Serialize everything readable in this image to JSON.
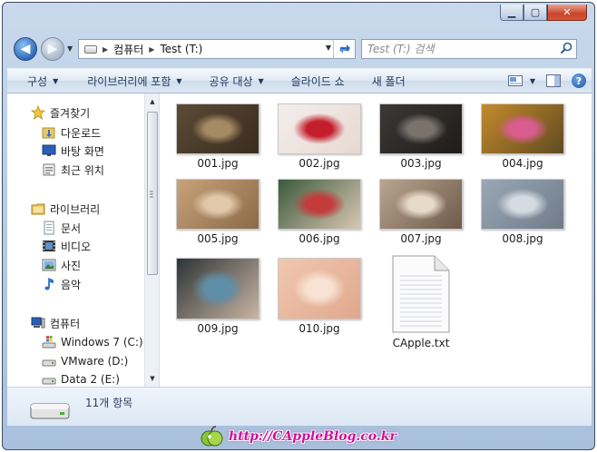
{
  "window": {
    "caption": {
      "minimize_glyph": "▁",
      "maximize_glyph": "▢",
      "close_glyph": "✕"
    }
  },
  "navbar": {
    "back_glyph": "◀",
    "forward_glyph": "▶",
    "breadcrumb": [
      "컴퓨터",
      "Test (T:)"
    ],
    "search_placeholder": "Test (T:) 검색"
  },
  "toolbar": {
    "items": [
      {
        "label": "구성",
        "has_caret": true
      },
      {
        "label": "라이브러리에 포함",
        "has_caret": true
      },
      {
        "label": "공유 대상",
        "has_caret": true
      },
      {
        "label": "슬라이드 쇼",
        "has_caret": false
      },
      {
        "label": "새 폴더",
        "has_caret": false
      }
    ],
    "help_glyph": "?"
  },
  "sidebar": {
    "favorites": {
      "label": "즐겨찾기",
      "items": [
        "다운로드",
        "바탕 화면",
        "최근 위치"
      ]
    },
    "libraries": {
      "label": "라이브러리",
      "items": [
        "문서",
        "비디오",
        "사진",
        "음악"
      ]
    },
    "computer": {
      "label": "컴퓨터",
      "items": [
        "Windows 7 (C:)",
        "VMware (D:)",
        "Data 2 (E:)"
      ]
    }
  },
  "files": [
    {
      "name": "001.jpg",
      "type": "image",
      "palette": [
        "#5b4a35",
        "#a58a63",
        "#3a2c1f"
      ]
    },
    {
      "name": "002.jpg",
      "type": "image",
      "palette": [
        "#f2eeec",
        "#c41d2b",
        "#e8d8d2"
      ]
    },
    {
      "name": "003.jpg",
      "type": "image",
      "palette": [
        "#3b3836",
        "#7a736d",
        "#1f1c1a"
      ]
    },
    {
      "name": "004.jpg",
      "type": "image",
      "palette": [
        "#c48a2a",
        "#d95c8f",
        "#5f4a22"
      ]
    },
    {
      "name": "005.jpg",
      "type": "image",
      "palette": [
        "#c7a27a",
        "#e0c8a8",
        "#8c6a48"
      ]
    },
    {
      "name": "006.jpg",
      "type": "image",
      "palette": [
        "#3c5a3c",
        "#c33b3b",
        "#d9c7b3"
      ]
    },
    {
      "name": "007.jpg",
      "type": "image",
      "palette": [
        "#b9a590",
        "#e7d9c8",
        "#6d5a49"
      ]
    },
    {
      "name": "008.jpg",
      "type": "image",
      "palette": [
        "#9aa8b6",
        "#d4dbe2",
        "#6f7b88"
      ]
    },
    {
      "name": "009.jpg",
      "type": "image",
      "palette": [
        "#2d3436",
        "#5f8fa8",
        "#c9b4a3"
      ]
    },
    {
      "name": "010.jpg",
      "type": "image",
      "palette": [
        "#f0c8b0",
        "#f7e2d4",
        "#e0a88c"
      ]
    },
    {
      "name": "CApple.txt",
      "type": "text"
    }
  ],
  "status": {
    "count": "11개 항목"
  },
  "watermark": "http://CAppleBlog.co.kr"
}
